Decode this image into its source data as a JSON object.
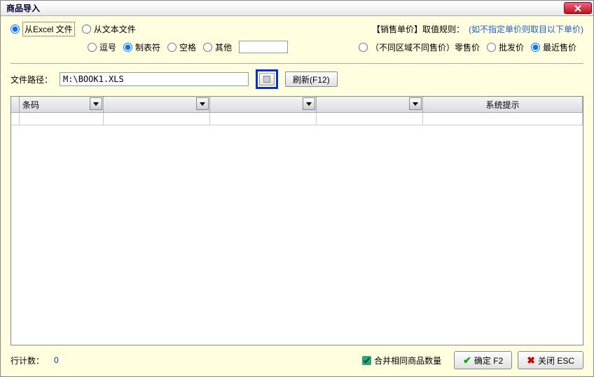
{
  "title": "商品导入",
  "source": {
    "excel": "从Excel 文件",
    "text": "从文本文件",
    "selected": "excel"
  },
  "delimiter": {
    "comma": "逗号",
    "tab": "制表符",
    "space": "空格",
    "other": "其他",
    "other_value": "",
    "selected": "tab"
  },
  "price_rule": {
    "label": "【销售单价】取值规则：",
    "note": "(如不指定单价则取目以下单价)",
    "region": "（不同区域不同售价）零售价",
    "wholesale": "批发价",
    "recent": "最近售价",
    "selected": "recent"
  },
  "path": {
    "label": "文件路径：",
    "value": "M:\\BOOK1.XLS",
    "refresh": "刷新(F12)"
  },
  "grid": {
    "col1": "条码",
    "col5": "系统提示"
  },
  "footer": {
    "count_label": "行计数：",
    "count_value": "0",
    "merge": "合并相同商品数量",
    "ok": "确定 F2",
    "cancel": "关闭 ESC"
  }
}
